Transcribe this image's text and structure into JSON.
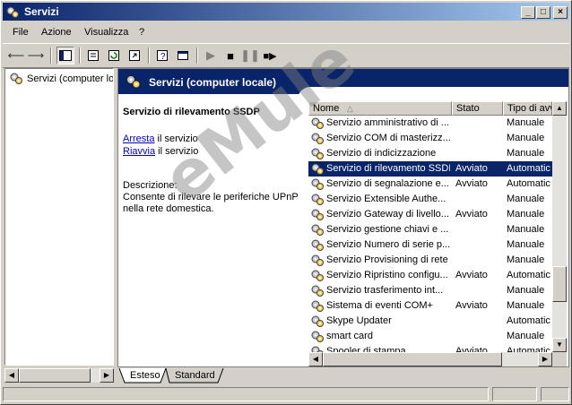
{
  "window": {
    "title": "Servizi"
  },
  "menu": [
    {
      "label": "File"
    },
    {
      "label": "Azione"
    },
    {
      "label": "Visualizza"
    },
    {
      "label": "?"
    }
  ],
  "tree": {
    "root_label": "Servizi (computer lo"
  },
  "header": {
    "title": "Servizi (computer locale)"
  },
  "detail": {
    "service_name": "Servizio di rilevamento SSDP",
    "stop_link": "Arresta",
    "stop_suffix": " il servizio",
    "restart_link": "Riavvia",
    "restart_suffix": " il servizio",
    "description_label": "Descrizione:",
    "description_line1": "Consente di rilevare le periferiche UPnP",
    "description_line2": "nella rete domestica."
  },
  "columns": {
    "name": "Nome",
    "status": "Stato",
    "startup": "Tipo di avv"
  },
  "rows": [
    {
      "name": "Servizio amministrativo di ...",
      "status": "",
      "startup": "Manuale"
    },
    {
      "name": "Servizio COM di masterizz...",
      "status": "",
      "startup": "Manuale"
    },
    {
      "name": "Servizio di indicizzazione",
      "status": "",
      "startup": "Manuale"
    },
    {
      "name": "Servizio di rilevamento SSDP",
      "status": "Avviato",
      "startup": "Automatic"
    },
    {
      "name": "Servizio di segnalazione e...",
      "status": "Avviato",
      "startup": "Automatic"
    },
    {
      "name": "Servizio Extensible Authe...",
      "status": "",
      "startup": "Manuale"
    },
    {
      "name": "Servizio Gateway di livello...",
      "status": "Avviato",
      "startup": "Manuale"
    },
    {
      "name": "Servizio gestione chiavi e ...",
      "status": "",
      "startup": "Manuale"
    },
    {
      "name": "Servizio Numero di serie p...",
      "status": "",
      "startup": "Manuale"
    },
    {
      "name": "Servizio Provisioning di rete",
      "status": "",
      "startup": "Manuale"
    },
    {
      "name": "Servizio Ripristino configu...",
      "status": "Avviato",
      "startup": "Automatic"
    },
    {
      "name": "Servizio trasferimento int...",
      "status": "",
      "startup": "Manuale"
    },
    {
      "name": "Sistema di eventi COM+",
      "status": "Avviato",
      "startup": "Manuale"
    },
    {
      "name": "Skype Updater",
      "status": "",
      "startup": "Automatic"
    },
    {
      "name": "smart card",
      "status": "",
      "startup": "Manuale"
    },
    {
      "name": "Spooler di stampa",
      "status": "Avviato",
      "startup": "Automatic"
    }
  ],
  "selected_row": 3,
  "tabs": [
    {
      "label": "Esteso"
    },
    {
      "label": "Standard"
    }
  ],
  "watermark": "eMule",
  "colors": {
    "title_bar": "#0a246a",
    "selection": "#0a246a",
    "face": "#d4d0c8"
  }
}
